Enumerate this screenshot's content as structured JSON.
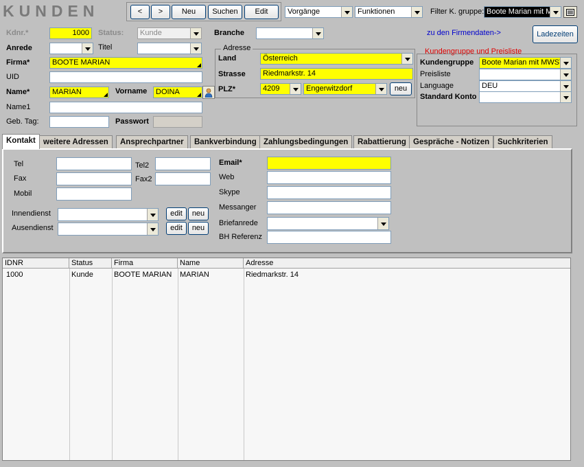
{
  "app_title": "KUNDEN",
  "toolbar": {
    "prev_label": "<",
    "next_label": ">",
    "new_label": "Neu",
    "search_label": "Suchen",
    "edit_label": "Edit",
    "vorgaenge": "Vorgänge",
    "funktionen": "Funktionen",
    "filter_label": "Filter K. gruppe:",
    "filter_value": "Boote Marian mit MWST"
  },
  "form": {
    "kdnr_label": "Kdnr.*",
    "kdnr_value": "1000",
    "status_label": "Status:",
    "status_value": "Kunde",
    "anrede_label": "Anrede",
    "anrede_value": "",
    "titel_label": "Titel",
    "titel_value": "",
    "firma_label": "Firma*",
    "firma_value": "BOOTE MARIAN",
    "uid_label": "UID",
    "uid_value": "",
    "name_label": "Name*",
    "name_value": "MARIAN",
    "vorname_label": "Vorname",
    "vorname_value": "DOINA",
    "name1_label": "Name1",
    "name1_value": "",
    "gebtag_label": "Geb. Tag:",
    "gebtag_value": "",
    "passwort_label": "Passwort",
    "passwort_value": "",
    "branche_label": "Branche",
    "branche_value": ""
  },
  "adresse": {
    "group_label": "Adresse",
    "land_label": "Land",
    "land_value": "Österreich",
    "strasse_label": "Strasse",
    "strasse_value": "Riedmarkstr. 14",
    "plz_label": "PLZ*",
    "plz_value": "4209",
    "ort_value": "Engerwitzdorf",
    "neu_label": "neu"
  },
  "right": {
    "firmendaten_link": "zu den Firmendaten->",
    "ladezeiten_label": "Ladezeiten",
    "group_title": "Kundengruppe und Preisliste",
    "kundengruppe_label": "Kundengruppe",
    "kundengruppe_value": "Boote Marian mit MWST",
    "preisliste_label": "Preisliste",
    "preisliste_value": "",
    "language_label": "Language",
    "language_value": "DEU",
    "konto_label": "Standard Konto",
    "konto_value": ""
  },
  "tabs": [
    {
      "label": "Kontakt"
    },
    {
      "label": "weitere Adressen"
    },
    {
      "label": "Ansprechpartner"
    },
    {
      "label": "Bankverbindung"
    },
    {
      "label": "Zahlungsbedingungen"
    },
    {
      "label": "Rabattierung"
    },
    {
      "label": "Gespräche - Notizen"
    },
    {
      "label": "Suchkriterien"
    }
  ],
  "kontakt": {
    "tel_label": "Tel",
    "tel_value": "",
    "tel2_label": "Tel2",
    "tel2_value": "",
    "fax_label": "Fax",
    "fax_value": "",
    "fax2_label": "Fax2",
    "fax2_value": "",
    "mobil_label": "Mobil",
    "mobil_value": "",
    "innendienst_label": "Innendienst",
    "innendienst_value": "",
    "ausendienst_label": "Ausendienst",
    "ausendienst_value": "",
    "edit_label": "edit",
    "neu_label": "neu",
    "email_label": "Email*",
    "email_value": "",
    "web_label": "Web",
    "web_value": "",
    "skype_label": "Skype",
    "skype_value": "",
    "messanger_label": "Messanger",
    "messanger_value": "",
    "briefanrede_label": "Briefanrede",
    "briefanrede_value": "",
    "bhref_label": "BH Referenz",
    "bhref_value": ""
  },
  "grid": {
    "columns": [
      "IDNR",
      "Status",
      "Firma",
      "Name",
      "Adresse"
    ],
    "rows": [
      [
        "1000",
        "Kunde",
        "BOOTE MARIAN",
        "MARIAN",
        "Riedmarkstr. 14"
      ]
    ]
  }
}
